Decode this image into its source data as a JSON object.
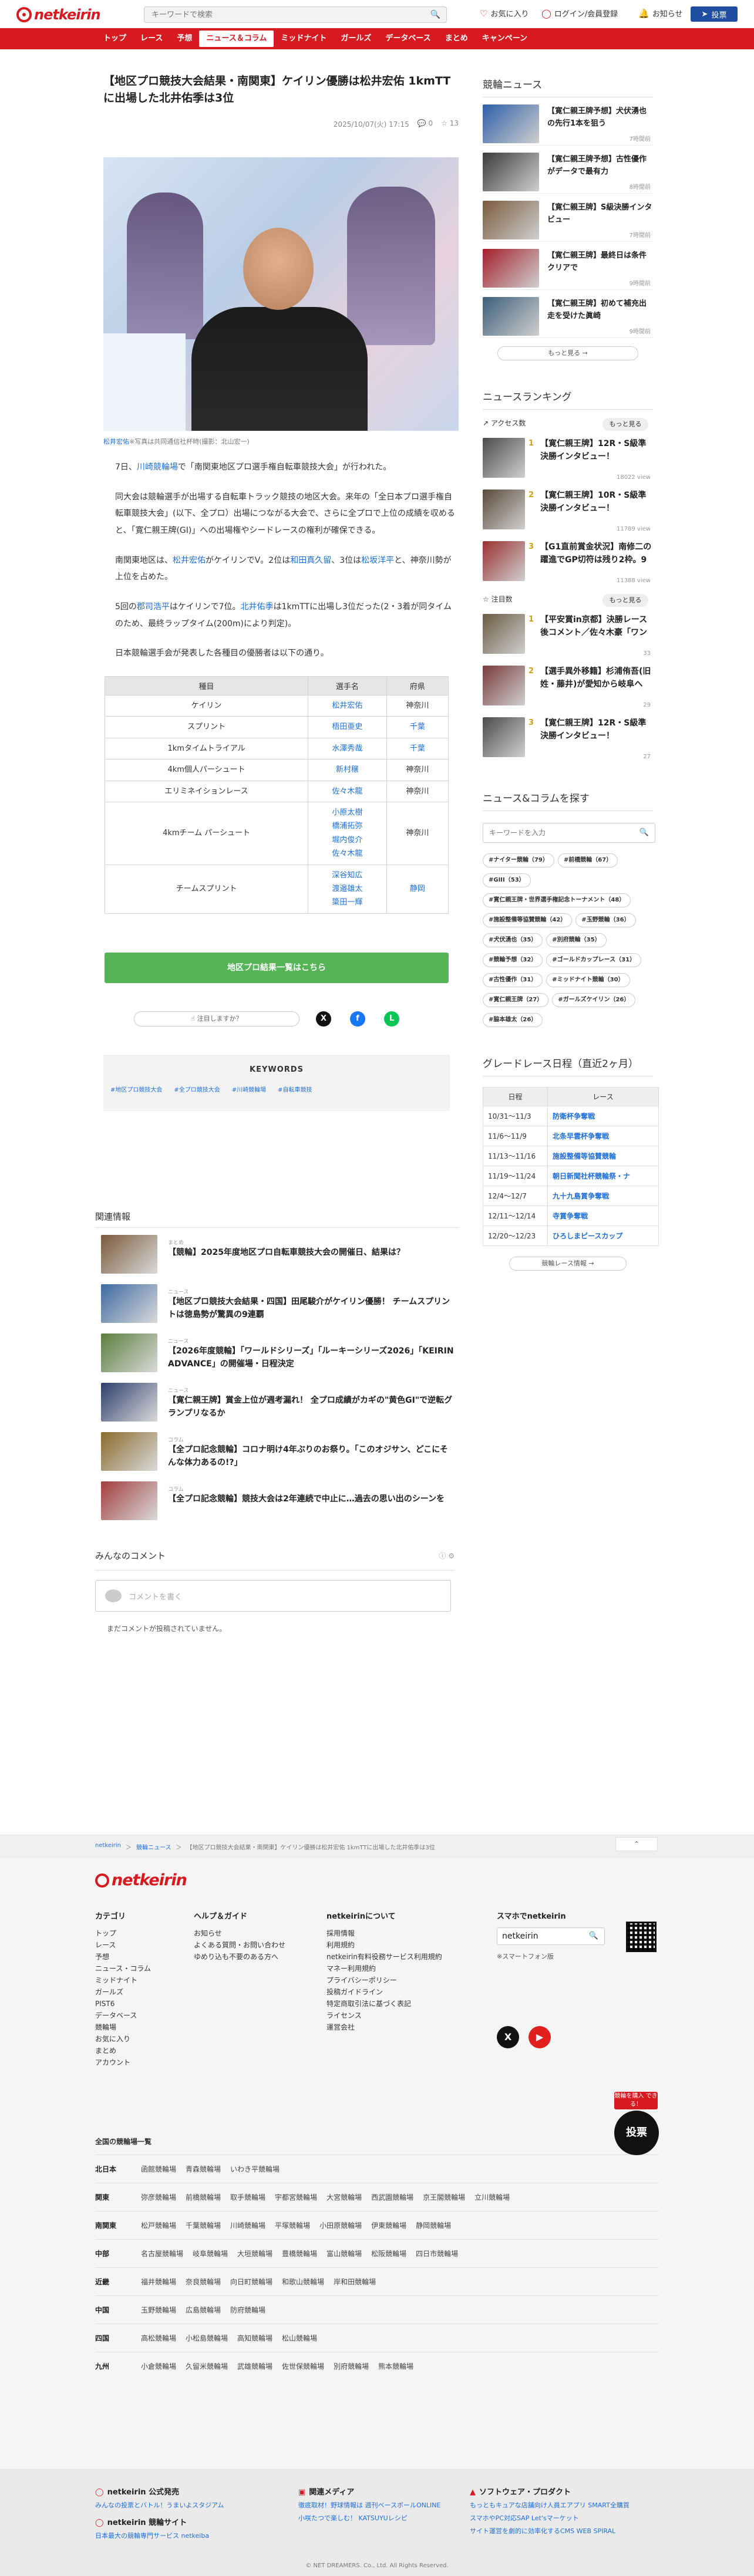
{
  "header": {
    "logo_text": "netkeirin",
    "search_placeholder": "キーワードで検索",
    "favorite_label": "お気に入り",
    "login_label": "ログイン/会員登録",
    "notice_label": "お知らせ",
    "vote_label": "投票"
  },
  "nav": {
    "items": [
      "トップ",
      "レース",
      "予想",
      "ニュース＆コラム",
      "ミッドナイト",
      "ガールズ",
      "データベース",
      "まとめ",
      "キャンペーン"
    ]
  },
  "article": {
    "title": "【地区プロ競技大会結果・南関東】ケイリン優勝は松井宏佑 1kmTTに出場した北井佑季は3位",
    "date": "2025/10/07(火) 17:15",
    "comments": "0",
    "likes": "13",
    "caption_name": "松井宏佑",
    "caption_text": "※写真は共同通信社杯時(撮影：北山宏一)",
    "p1_a": "7日、",
    "p1_link": "川崎競輪場",
    "p1_b": "で「南関東地区プロ選手権自転車競技大会」が行われた。",
    "p2": "同大会は競輪選手が出場する自転車トラック競技の地区大会。来年の「全日本プロ選手権自転車競技大会」(以下、全プロ）出場につながる大会で、さらに全プロで上位の成績を収めると、「寛仁親王牌(GI)」への出場権やシードレースの権利が確保できる。",
    "p3_a": "南関東地区は、",
    "p3_link1": "松井宏佑",
    "p3_b": "がケイリンでV。2位は",
    "p3_link2": "和田真久留",
    "p3_c": "、3位は",
    "p3_link3": "松坂洋平",
    "p3_d": "と、神奈川勢が上位を占めた。",
    "p4_a": "5回の",
    "p4_link1": "郡司浩平",
    "p4_b": "はケイリンで7位。",
    "p4_link2": "北井佑季",
    "p4_c": "は1kmTTに出場し3位だった(2・3着が同タイムのため、最終ラップタイム(200m)により判定)。",
    "p5": "日本競輪選手会が発表した各種目の優勝者は以下の通り。",
    "table_headers": [
      "種目",
      "選手名",
      "府県"
    ],
    "table_rows": [
      {
        "event": "ケイリン",
        "players": [
          "松井宏佑"
        ],
        "pref": "神奈川",
        "pref_link": false
      },
      {
        "event": "スプリント",
        "players": [
          "梧田亜史"
        ],
        "pref": "千葉",
        "pref_link": true
      },
      {
        "event": "1kmタイムトライアル",
        "players": [
          "水澤秀哉"
        ],
        "pref": "千葉",
        "pref_link": true
      },
      {
        "event": "4km個人パーシュート",
        "players": [
          "新村穣"
        ],
        "pref": "神奈川",
        "pref_link": false
      },
      {
        "event": "エリミネイションレース",
        "players": [
          "佐々木龍"
        ],
        "pref": "神奈川",
        "pref_link": false
      },
      {
        "event": "4kmチーム パーシュート",
        "players": [
          "小原太樹",
          "橋浦拓弥",
          "堀内俊介",
          "佐々木龍"
        ],
        "pref": "神奈川",
        "pref_link": false
      },
      {
        "event": "チームスプリント",
        "players": [
          "深谷知広",
          "渡邉雄太",
          "簗田一輝"
        ],
        "pref": "静岡",
        "pref_link": true
      }
    ],
    "results_link": "地区プロ結果一覧はこちら",
    "like_prompt": "注目しますか？",
    "keywords_title": "KEYWORDS",
    "keywords": [
      "#地区プロ競技大会",
      "#全プロ競技大会",
      "#川崎競輪場",
      "#自転車競技"
    ]
  },
  "related": {
    "title": "関連情報",
    "items": [
      {
        "tag": "まとめ",
        "title": "【競輪】2025年度地区プロ自転車競技大会の開催日、結果は？"
      },
      {
        "tag": "ニュース",
        "title": "【地区プロ競技大会結果・四国】田尾駿介がケイリン優勝！ チームスプリントは徳島勢が驚異の9連覇"
      },
      {
        "tag": "ニュース",
        "title": "【2026年度競輪】「ワールドシリーズ」「ルーキーシリーズ2026」「KEIRIN ADVANCE」の開催場・日程決定"
      },
      {
        "tag": "ニュース",
        "title": "【寛仁親王牌】賞金上位が週考漏れ！ 全プロ成績がカギの\"黄色GI\"で逆転グランプリなるか"
      },
      {
        "tag": "コラム",
        "title": "【全プロ記念競輪】コロナ明け4年ぶりのお祭り。「このオジサン、どこにそんな体力あるの!?」"
      },
      {
        "tag": "コラム",
        "title": "【全プロ記念競輪】競技大会は2年連続で中止に…過去の思い出のシーンを"
      }
    ]
  },
  "comments": {
    "title": "みんなのコメント",
    "box_placeholder": "コメントを書く",
    "empty": "まだコメントが投稿されていません。"
  },
  "side": {
    "news_title": "競輪ニュース",
    "news": [
      {
        "text": "【寛仁親王牌予想】犬伏湧也の先行1本を狙う",
        "meta": "7時間前"
      },
      {
        "text": "【寛仁親王牌予想】古性優作がデータで最有力",
        "meta": "8時間前"
      },
      {
        "text": "【寛仁親王牌】S級決勝インタビュー",
        "meta": "7時間前"
      },
      {
        "text": "【寛仁親王牌】最終日は条件クリアで",
        "meta": "9時間前"
      },
      {
        "text": "【寛仁親王牌】初めて補充出走を受けた眞崎",
        "meta": "9時間前"
      }
    ],
    "more_label": "もっと見る",
    "ranking_title": "ニュースランキング",
    "access_label": "アクセス数",
    "access_rank": [
      {
        "no": "1",
        "text": "【寛仁親王牌】12R・S級準決勝インタビュー！",
        "meta": "18022 view"
      },
      {
        "no": "2",
        "text": "【寛仁親王牌】10R・S級準決勝インタビュー！",
        "meta": "11789 view"
      },
      {
        "no": "3",
        "text": "【G1直前賞金状況】南修二の躍進でGP切符は残り2枠。9",
        "meta": "11388 view"
      }
    ],
    "attention_label": "注目数",
    "attention_rank": [
      {
        "no": "1",
        "text": "【平安賞in京都】決勝レース後コメント／佐々木豪「ワン",
        "meta": "33"
      },
      {
        "no": "2",
        "text": "【選手異外移籍】杉浦侑吾(旧姓・藤井)が愛知から岐阜へ",
        "meta": "29"
      },
      {
        "no": "3",
        "text": "【寛仁親王牌】12R・S級準決勝インタビュー！",
        "meta": "27"
      }
    ],
    "explore_title": "ニュース&コラムを探す",
    "explore_placeholder": "キーワードを入力",
    "tags": [
      "#ナイター競輪（79）",
      "#前橋競輪（67）",
      "#GIII（53）",
      "#寛仁親王牌・世界選手権記念トーナメント（48）",
      "#施設整備等協賛競輪（42）",
      "#玉野競輪（36）",
      "#犬伏湧也（35）",
      "#別府競輪（35）",
      "#競輪予想（32）",
      "#ゴールドカップレース（31）",
      "#古性優作（31）",
      "#ミッドナイト競輪（30）",
      "#寛仁親王牌（27）",
      "#ガールズケイリン（26）",
      "#脇本雄太（26）"
    ],
    "grade_title": "グレードレース日程（直近2ヶ月）",
    "grade_headers": [
      "日程",
      "レース"
    ],
    "grade_rows": [
      {
        "date": "10/31～11/3",
        "race": "防衛杯争奪戦"
      },
      {
        "date": "11/6～11/9",
        "race": "北条早雲杯争奪戦"
      },
      {
        "date": "11/13～11/16",
        "race": "施設整備等協賛競輪"
      },
      {
        "date": "11/19～11/24",
        "race": "朝日新聞社杯競輪祭・ナ"
      },
      {
        "date": "12/4～12/7",
        "race": "九十九島賞争奪戦"
      },
      {
        "date": "12/11～12/14",
        "race": "寺賞争奪戦"
      },
      {
        "date": "12/20～12/23",
        "race": "ひろしまピースカップ"
      }
    ],
    "grade_more": "競輪レース情報"
  },
  "breadcrumb": {
    "items": [
      "netkeirin",
      "競輪ニュース",
      "【地区プロ競技大会結果・南関東】ケイリン優勝は松井宏佑 1kmTTに出場した北井佑季は3位"
    ],
    "sep": "＞"
  },
  "footer": {
    "logo_text": "netkeirin",
    "cat_title": "カテゴリ",
    "cats": [
      "トップ",
      "レース",
      "予想",
      "ニュース・コラム",
      "ミッドナイト",
      "ガールズ",
      "PIST6",
      "データベース",
      "競輪場",
      "お気に入り",
      "まとめ",
      "アカウント"
    ],
    "help_title": "ヘルプ＆ガイド",
    "help": [
      "お知らせ",
      "よくある質問・お問い合わせ",
      "ゆめり込も不要のある方へ"
    ],
    "about_title": "netkeirinについて",
    "about": [
      "採用情報",
      "利用規約",
      "netkeirin有料役務サービス利用規約",
      "マネー利用規約",
      "プライバシーポリシー",
      "投稿ガイドライン",
      "特定商取引法に基づく表記",
      "ライセンス",
      "運営会社"
    ],
    "app_title": "スマホでnetkeirin",
    "app_search_value": "netkeirin",
    "app_note": "※スマートフォン版",
    "venues_title": "全国の競輪場一覧",
    "venues": [
      {
        "region": "北日本",
        "list": [
          "函館競輪場",
          "青森競輪場",
          "いわき平競輪場"
        ]
      },
      {
        "region": "関東",
        "list": [
          "弥彦競輪場",
          "前橋競輪場",
          "取手競輪場",
          "宇都宮競輪場",
          "大宮競輪場",
          "西武園競輪場",
          "京王閣競輪場",
          "立川競輪場"
        ]
      },
      {
        "region": "南関東",
        "list": [
          "松戸競輪場",
          "千葉競輪場",
          "川崎競輪場",
          "平塚競輪場",
          "小田原競輪場",
          "伊東競輪場",
          "静岡競輪場"
        ]
      },
      {
        "region": "中部",
        "list": [
          "名古屋競輪場",
          "岐阜競輪場",
          "大垣競輪場",
          "豊橋競輪場",
          "富山競輪場",
          "松阪競輪場",
          "四日市競輪場"
        ]
      },
      {
        "region": "近畿",
        "list": [
          "福井競輪場",
          "奈良競輪場",
          "向日町競輪場",
          "和歌山競輪場",
          "岸和田競輪場"
        ]
      },
      {
        "region": "中国",
        "list": [
          "玉野競輪場",
          "広島競輪場",
          "防府競輪場"
        ]
      },
      {
        "region": "四国",
        "list": [
          "高松競輪場",
          "小松島競輪場",
          "高知競輪場",
          "松山競輪場"
        ]
      },
      {
        "region": "九州",
        "list": [
          "小倉競輪場",
          "久留米競輪場",
          "武雄競輪場",
          "佐世保競輪場",
          "別府競輪場",
          "熊本競輪場"
        ]
      }
    ],
    "vote_tag": "競輪を購入 できる！",
    "vote_label": "投票",
    "bottom": {
      "official_title": "netkeirin 公式発売",
      "official_items": [
        "みんなの投票とバトル！うまいよスタジアム"
      ],
      "official2_title": "netkeirin 競輪サイト",
      "official2_items": [
        "日本最大の競輪専門サービス netkeiba"
      ],
      "media_title": "関連メディア",
      "media_items": [
        "徹底取材！野球情報は 週刊ベースボールONLINE",
        "小咲たつで楽しむ！ KATSUYUレシピ"
      ],
      "soft_title": "ソフトウェア・プロダクト",
      "soft_items": [
        "もっともキュアな店舗向け人員エアプリ SMART全購買",
        "スマホやPC対応SAP Let'sマーケット",
        "サイト運営を劇的に効率化するCMS WEB SPIRAL"
      ]
    },
    "copyright": "© NET DREAMERS. Co., Ltd. All Rights Reserved."
  },
  "colors": {
    "brand": "#d71920",
    "link": "#1e6fd9",
    "green_button": "#55b455",
    "vote_button": "#1f4ea0"
  }
}
